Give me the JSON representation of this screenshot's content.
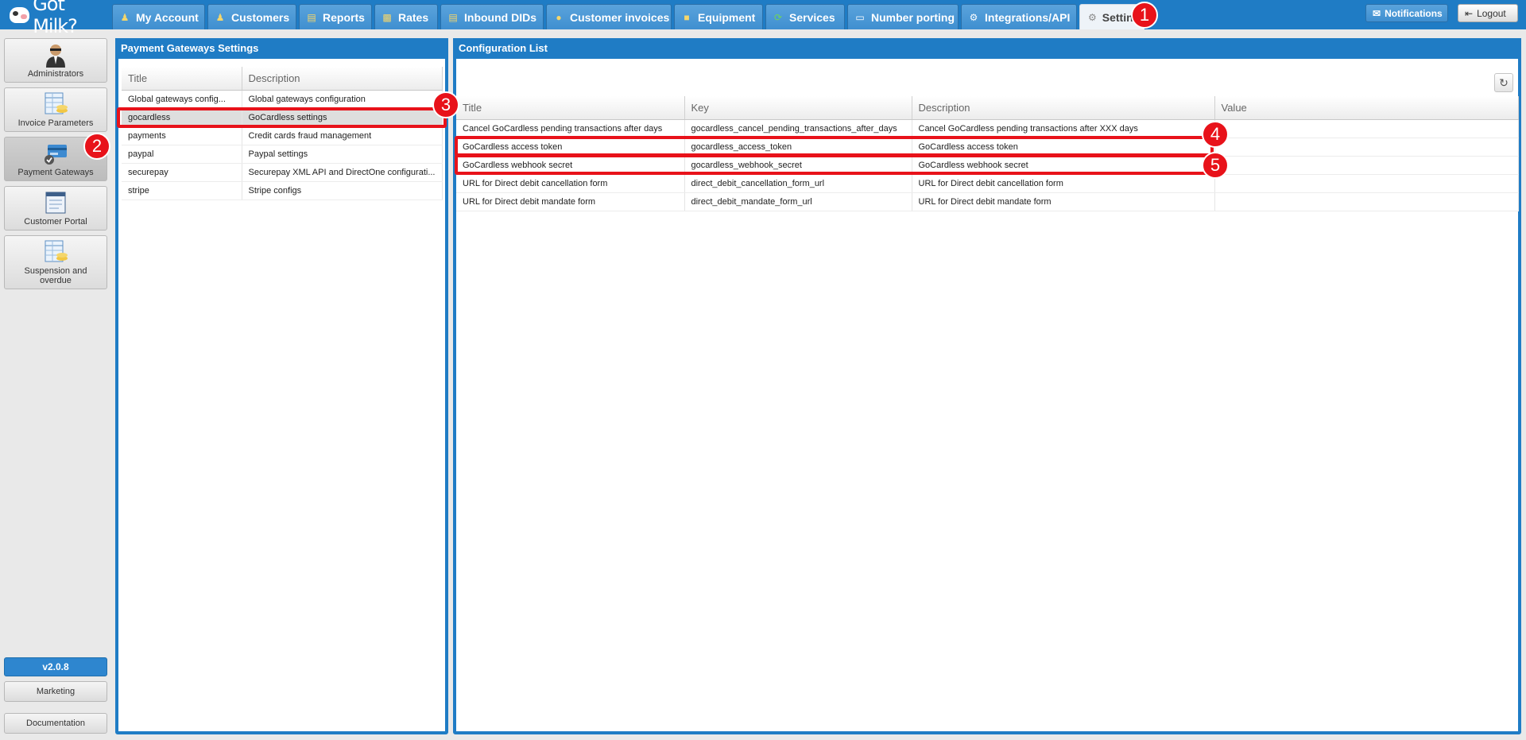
{
  "app": {
    "logo_text": "Got Milk?"
  },
  "tabs": [
    {
      "label": "My Account",
      "icon": "user-icon"
    },
    {
      "label": "Customers",
      "icon": "customer-icon"
    },
    {
      "label": "Reports",
      "icon": "report-icon"
    },
    {
      "label": "Rates",
      "icon": "rates-icon"
    },
    {
      "label": "Inbound DIDs",
      "icon": "did-icon"
    },
    {
      "label": "Customer invoices",
      "icon": "coins-icon"
    },
    {
      "label": "Equipment",
      "icon": "box-icon"
    },
    {
      "label": "Services",
      "icon": "services-icon"
    },
    {
      "label": "Number porting",
      "icon": "porting-icon"
    },
    {
      "label": "Integrations/API",
      "icon": "gear-icon"
    },
    {
      "label": "Settings",
      "icon": "gears-icon"
    }
  ],
  "topbar": {
    "notifications_label": "Notifications",
    "logout_label": "Logout"
  },
  "markers": [
    "1",
    "2",
    "3",
    "4",
    "5"
  ],
  "sidebar": {
    "items": [
      {
        "label": "Administrators",
        "icon": "administrator-icon"
      },
      {
        "label": "Invoice Parameters",
        "icon": "invoice-parameters-icon"
      },
      {
        "label": "Payment Gateways",
        "icon": "payment-card-icon"
      },
      {
        "label": "Customer Portal",
        "icon": "portal-icon"
      },
      {
        "label": "Suspension and overdue",
        "icon": "suspension-icon"
      }
    ],
    "version": "v2.0.8",
    "marketing_label": "Marketing",
    "documentation_label": "Documentation"
  },
  "gateways_panel": {
    "title": "Payment Gateways Settings",
    "columns": [
      "Title",
      "Description"
    ],
    "rows": [
      {
        "title": "Global gateways config...",
        "description": "Global gateways configuration"
      },
      {
        "title": "gocardless",
        "description": "GoCardless settings"
      },
      {
        "title": "payments",
        "description": "Credit cards fraud management"
      },
      {
        "title": "paypal",
        "description": "Paypal settings"
      },
      {
        "title": "securepay",
        "description": "Securepay XML API and DirectOne configurati..."
      },
      {
        "title": "stripe",
        "description": "Stripe configs"
      }
    ]
  },
  "config_panel": {
    "title": "Configuration List",
    "columns": [
      "Title",
      "Key",
      "Description",
      "Value"
    ],
    "rows": [
      {
        "title": "Cancel GoCardless pending transactions after days",
        "key": "gocardless_cancel_pending_transactions_after_days",
        "description": "Cancel GoCardless pending transactions after XXX days",
        "value": ""
      },
      {
        "title": "GoCardless access token",
        "key": "gocardless_access_token",
        "description": "GoCardless access token",
        "value": ""
      },
      {
        "title": "GoCardless webhook secret",
        "key": "gocardless_webhook_secret",
        "description": "GoCardless webhook secret",
        "value": ""
      },
      {
        "title": "URL for Direct debit cancellation form",
        "key": "direct_debit_cancellation_form_url",
        "description": "URL for Direct debit cancellation form",
        "value": ""
      },
      {
        "title": "URL for Direct debit mandate form",
        "key": "direct_debit_mandate_form_url",
        "description": "URL for Direct debit mandate form",
        "value": ""
      }
    ]
  }
}
